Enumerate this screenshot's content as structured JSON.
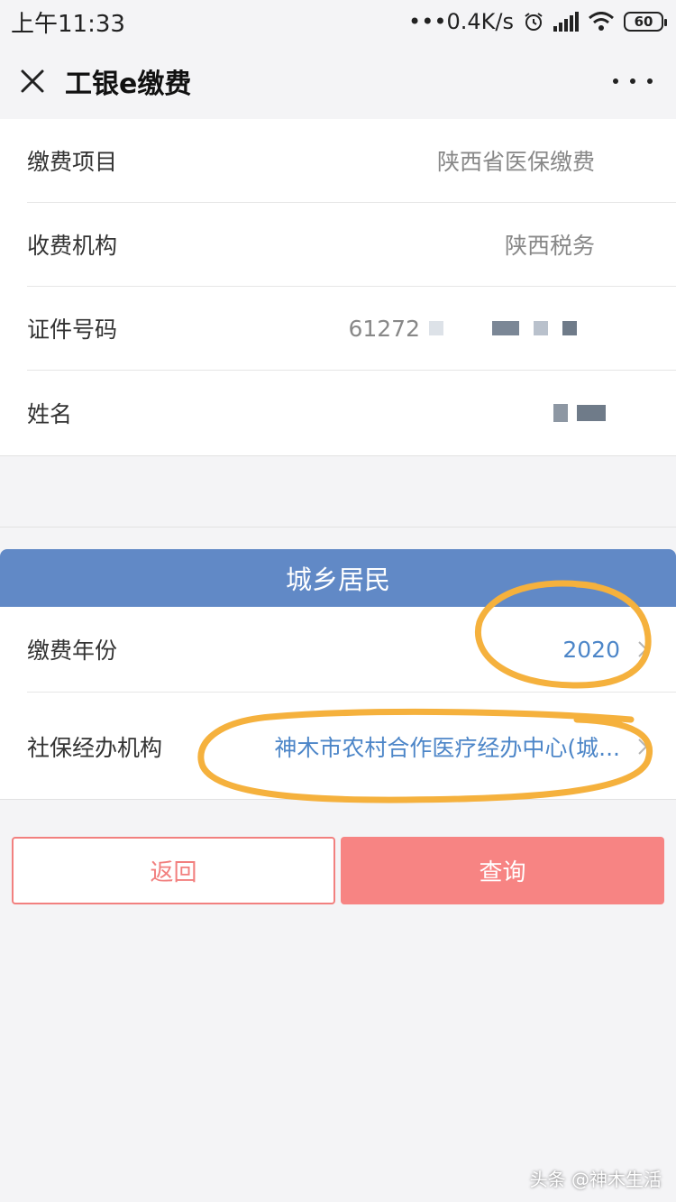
{
  "status_bar": {
    "time": "上午11:33",
    "network_speed": "•••0.4K/s",
    "battery": "60"
  },
  "nav": {
    "title": "工银e缴费"
  },
  "info": {
    "rows": [
      {
        "label": "缴费项目",
        "value": "陕西省医保缴费"
      },
      {
        "label": "收费机构",
        "value": "陕西税务"
      },
      {
        "label": "证件号码",
        "value": "61272"
      },
      {
        "label": "姓名",
        "value": ""
      }
    ]
  },
  "section": {
    "header": "城乡居民",
    "year_label": "缴费年份",
    "year_value": "2020",
    "agency_label": "社保经办机构",
    "agency_value": "神木市农村合作医疗经办中心(城..."
  },
  "buttons": {
    "back": "返回",
    "query": "查询"
  },
  "watermark": "头条 @神木生活",
  "colors": {
    "header_blue": "#6189c6",
    "value_blue": "#4d86c8",
    "button_red": "#f78483",
    "annotation_orange": "#f5b13d"
  }
}
